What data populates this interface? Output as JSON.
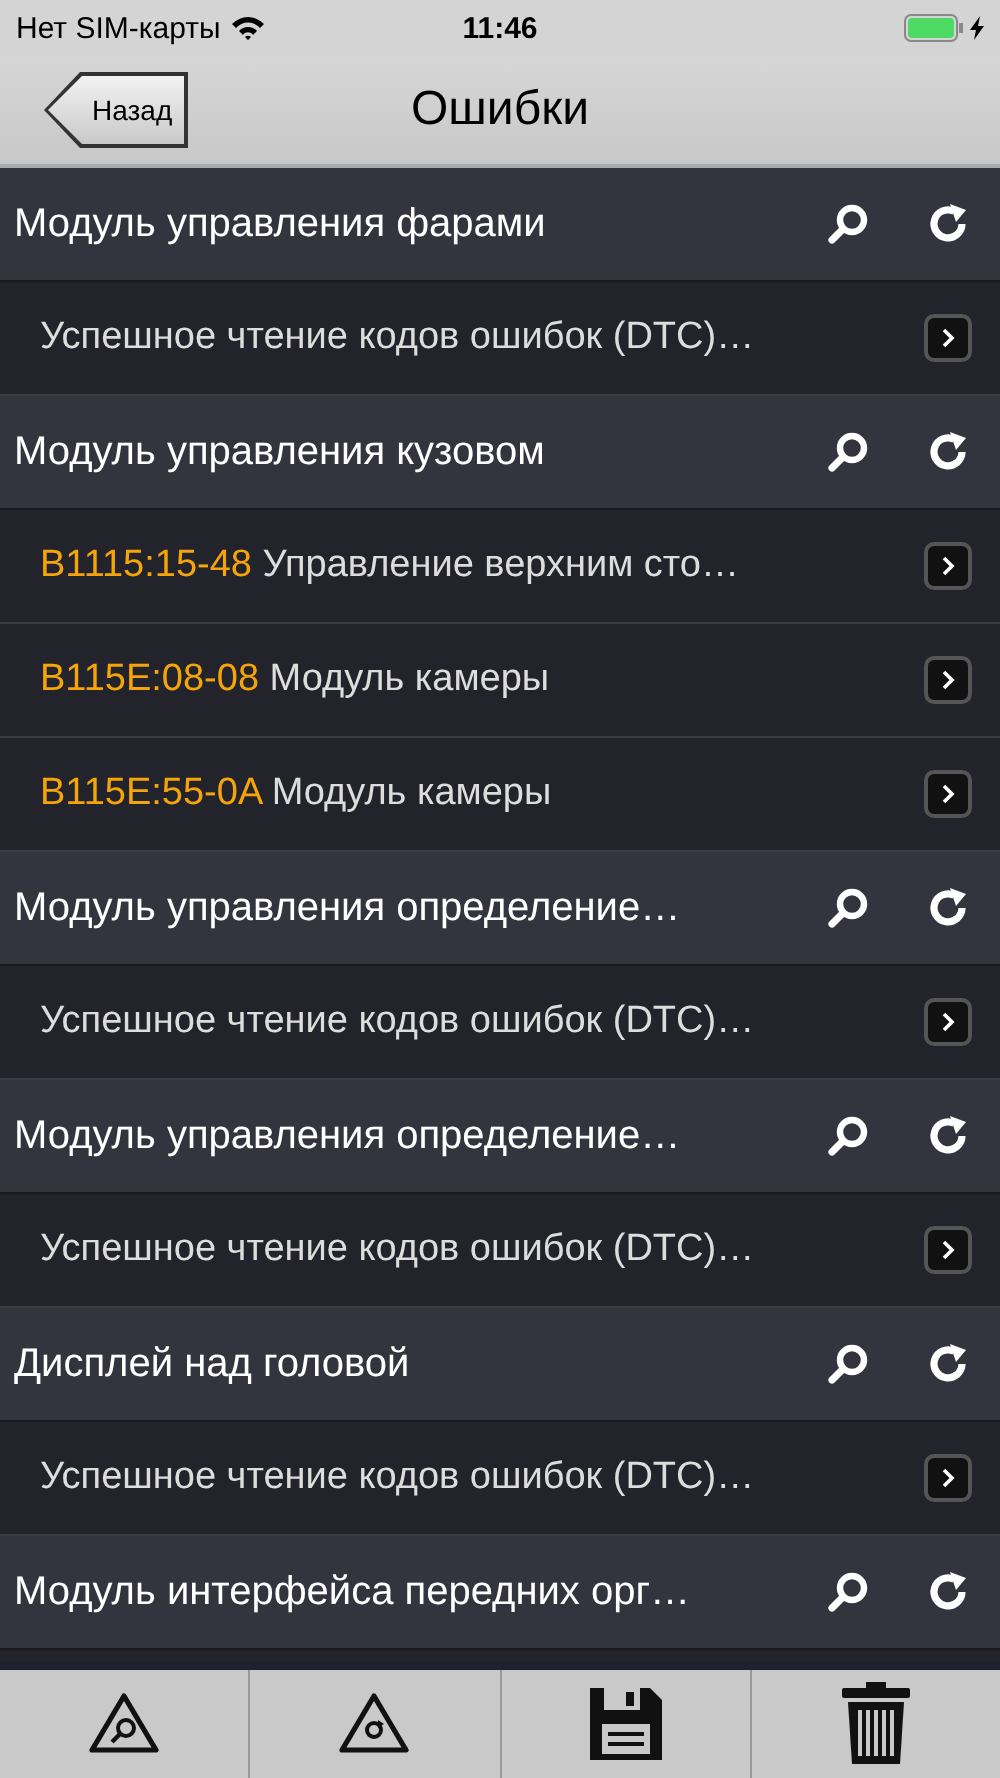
{
  "status_bar": {
    "carrier": "Нет SIM-карты",
    "time": "11:46",
    "charging": true
  },
  "nav": {
    "back": "Назад",
    "title": "Ошибки"
  },
  "modules": [
    {
      "name": "Модуль управления фарами",
      "items": [
        {
          "kind": "status",
          "text": "Успешное чтение кодов ошибок (DTC)…"
        }
      ]
    },
    {
      "name": "Модуль управления кузовом",
      "items": [
        {
          "kind": "dtc",
          "code": "B1115:15-48",
          "text": "Управление верхним сто…"
        },
        {
          "kind": "dtc",
          "code": "B115E:08-08",
          "text": "Модуль камеры"
        },
        {
          "kind": "dtc",
          "code": "B115E:55-0A",
          "text": "Модуль камеры"
        }
      ]
    },
    {
      "name": "Модуль управления определение…",
      "items": [
        {
          "kind": "status",
          "text": "Успешное чтение кодов ошибок (DTC)…"
        }
      ]
    },
    {
      "name": "Модуль управления определение…",
      "items": [
        {
          "kind": "status",
          "text": "Успешное чтение кодов ошибок (DTC)…"
        }
      ]
    },
    {
      "name": "Дисплей над головой",
      "items": [
        {
          "kind": "status",
          "text": "Успешное чтение кодов ошибок (DTC)…"
        }
      ]
    },
    {
      "name": "Модуль интерфейса передних орг…"
    }
  ]
}
